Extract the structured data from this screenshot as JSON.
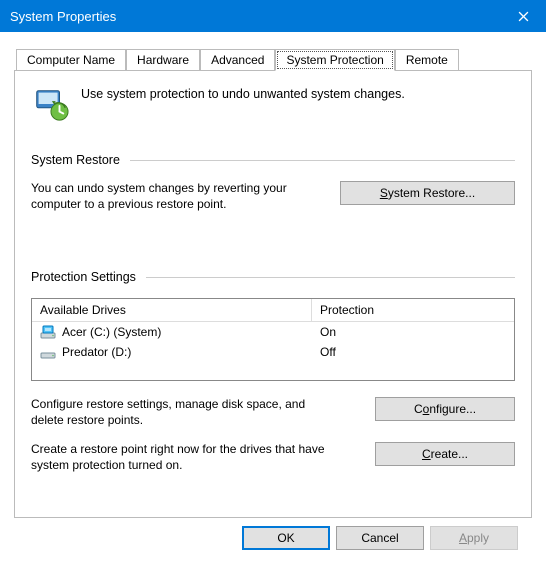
{
  "window": {
    "title": "System Properties"
  },
  "tabs": [
    {
      "label": "Computer Name"
    },
    {
      "label": "Hardware"
    },
    {
      "label": "Advanced"
    },
    {
      "label": "System Protection",
      "selected": true
    },
    {
      "label": "Remote"
    }
  ],
  "intro": "Use system protection to undo unwanted system changes.",
  "system_restore": {
    "header": "System Restore",
    "text": "You can undo system changes by reverting your computer to a previous restore point.",
    "button": "System Restore..."
  },
  "protection_settings": {
    "header": "Protection Settings",
    "columns": {
      "drives": "Available Drives",
      "protection": "Protection"
    },
    "rows": [
      {
        "name": "Acer (C:) (System)",
        "protection": "On",
        "system": true
      },
      {
        "name": "Predator (D:)",
        "protection": "Off",
        "system": false
      }
    ],
    "configure_text": "Configure restore settings, manage disk space, and delete restore points.",
    "configure_button": "Configure...",
    "create_text": "Create a restore point right now for the drives that have system protection turned on.",
    "create_button": "Create..."
  },
  "footer": {
    "ok": "OK",
    "cancel": "Cancel",
    "apply": "Apply"
  }
}
